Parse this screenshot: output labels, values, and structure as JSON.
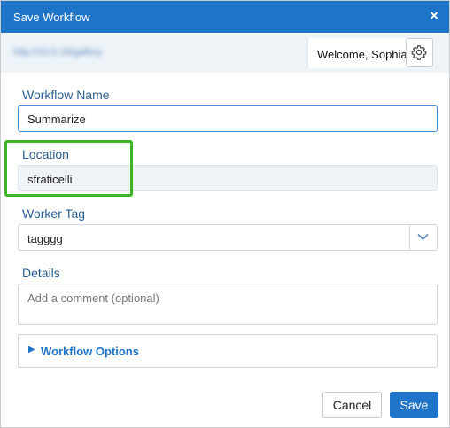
{
  "dialog": {
    "title": "Save Workflow",
    "close_glyph": "×"
  },
  "header": {
    "url": "http://10.9.19/gallery",
    "welcome": "Welcome, Sophia",
    "settings_icon": "gear-icon"
  },
  "form": {
    "workflow_name": {
      "label": "Workflow Name",
      "value": "Summarize"
    },
    "location": {
      "label": "Location",
      "value": "sfraticelli"
    },
    "worker_tag": {
      "label": "Worker Tag",
      "value": "tagggg"
    },
    "details": {
      "label": "Details",
      "placeholder": "Add a comment (optional)"
    },
    "options": {
      "label": "Workflow Options",
      "expander_glyph": "▶"
    }
  },
  "buttons": {
    "cancel": "Cancel",
    "save": "Save"
  },
  "colors": {
    "accent": "#1e74c9",
    "highlight": "#3cb424",
    "label": "#2a5d8f"
  }
}
